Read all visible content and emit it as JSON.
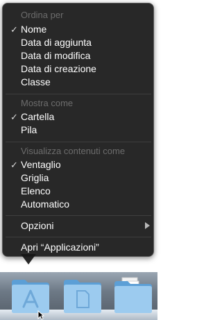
{
  "menu": {
    "sort_section": {
      "title": "Ordina per",
      "items": [
        {
          "label": "Nome",
          "checked": true
        },
        {
          "label": "Data di aggiunta",
          "checked": false
        },
        {
          "label": "Data di modifica",
          "checked": false
        },
        {
          "label": "Data di creazione",
          "checked": false
        },
        {
          "label": "Classe",
          "checked": false
        }
      ]
    },
    "display_section": {
      "title": "Mostra come",
      "items": [
        {
          "label": "Cartella",
          "checked": true
        },
        {
          "label": "Pila",
          "checked": false
        }
      ]
    },
    "view_section": {
      "title": "Visualizza contenuti come",
      "items": [
        {
          "label": "Ventaglio",
          "checked": true
        },
        {
          "label": "Griglia",
          "checked": false
        },
        {
          "label": "Elenco",
          "checked": false
        },
        {
          "label": "Automatico",
          "checked": false
        }
      ]
    },
    "options": {
      "label": "Opzioni",
      "icon": "submenu-arrow-icon"
    },
    "open": {
      "label": "Apri “Applicazioni”"
    },
    "check_glyph": "✓"
  },
  "dock": {
    "folders": [
      {
        "name": "applications-folder",
        "icon": "app-store-a-icon"
      },
      {
        "name": "documents-folder",
        "icon": "document-icon"
      },
      {
        "name": "downloads-folder",
        "icon": "documents-stack-icon"
      }
    ],
    "colors": {
      "folder_light": "#b9dcf5",
      "folder_dark": "#5c9fd6",
      "menu_bg": "#161616"
    }
  }
}
